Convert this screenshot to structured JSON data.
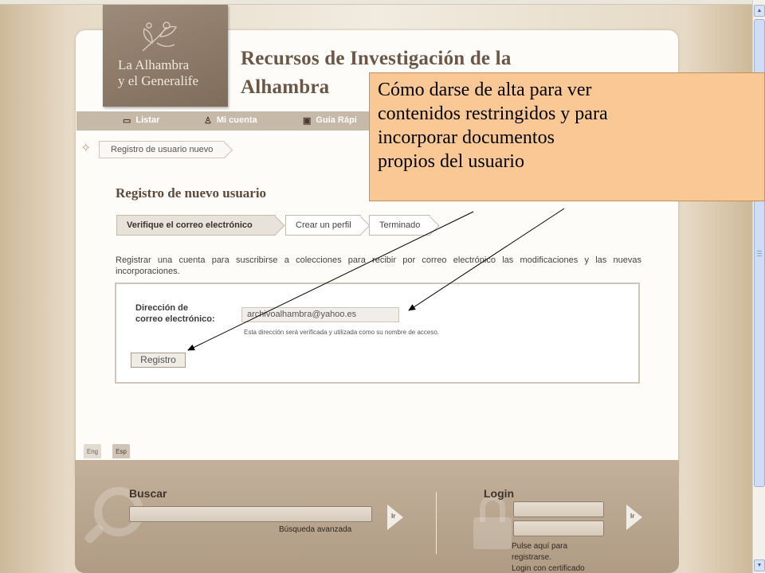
{
  "site": {
    "logo_line1": "La Alhambra",
    "logo_line2": "y el Generalife",
    "title_line1": "Recursos de Investigación de la",
    "title_line2": "Alhambra"
  },
  "nav": {
    "items": [
      {
        "label": "Listar",
        "icon": "list-icon"
      },
      {
        "label": "Mi cuenta",
        "icon": "user-icon"
      },
      {
        "label": "Guía Rápi",
        "icon": "guide-icon"
      }
    ]
  },
  "breadcrumb": {
    "label": "Registro de usuario nuevo"
  },
  "main": {
    "heading": "Registro de nuevo usuario",
    "steps": [
      {
        "label": "Verifique el correo electrónico",
        "active": true
      },
      {
        "label": "Crear un perfil",
        "active": false
      },
      {
        "label": "Terminado",
        "active": false
      }
    ],
    "intro": "Registrar una cuenta para suscribirse a colecciones para recibir por correo electrónico las modificaciones y las nuevas incorporaciones.",
    "email_label": "Dirección de correo electrónico:",
    "email_value": "archivoalhambra@yahoo.es",
    "email_help": "Esta dirección será verificada y utilizada como su nombre de acceso.",
    "register_button": "Registro"
  },
  "lang": {
    "eng": "Eng",
    "esp": "Esp",
    "active": "Esp"
  },
  "footer": {
    "search_title": "Buscar",
    "search_go": "Ir",
    "advanced_search": "Búsqueda avanzada",
    "login_title": "Login",
    "login_go": "Ir",
    "register_link_1": "Pulse aquí para",
    "register_link_2": "registrarse.",
    "cert_login": "Login con certificado"
  },
  "callout": {
    "line1": "Cómo darse de alta para ver",
    "line2": "contenidos restringidos y para",
    "line3": "incorporar documentos",
    "line4": "propios del usuario"
  },
  "colors": {
    "callout_bg": "#fac895",
    "nav_bg": "#c7b9a8",
    "footer_bg": "#b09c85",
    "title_text": "#6c5646"
  }
}
